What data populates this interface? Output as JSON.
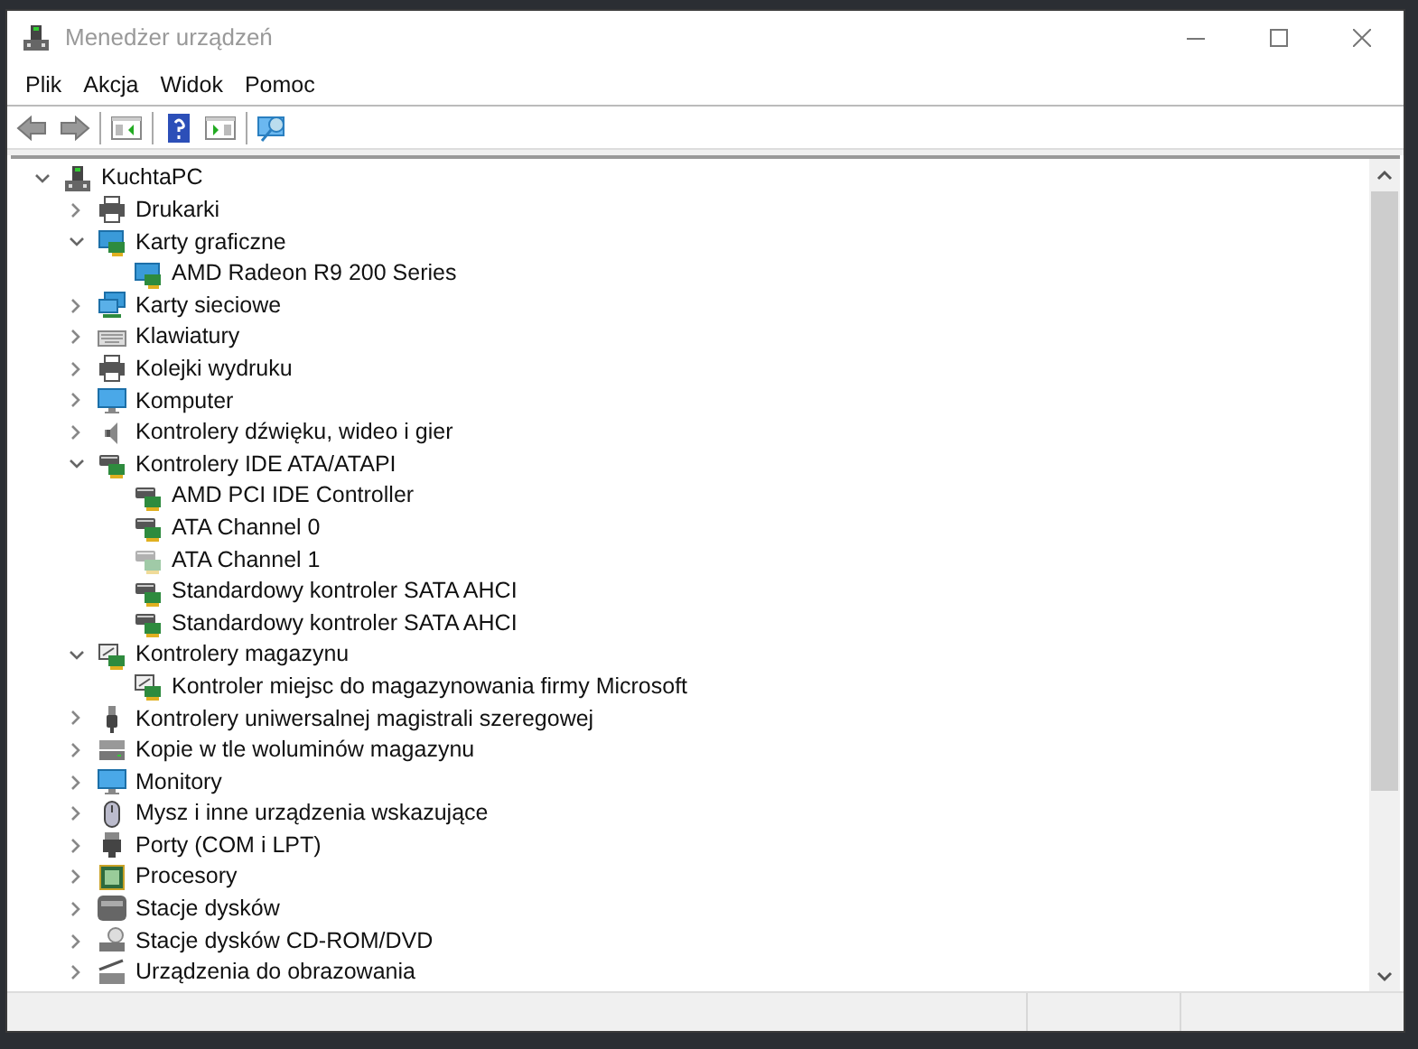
{
  "window": {
    "title": "Menedżer urządzeń"
  },
  "menu": [
    "Plik",
    "Akcja",
    "Widok",
    "Pomoc"
  ],
  "tree": {
    "label": "KuchtaPC",
    "kind": "computer",
    "expanded": true,
    "children": [
      {
        "label": "Drukarki",
        "kind": "printer",
        "expanded": false
      },
      {
        "label": "Karty graficzne",
        "kind": "display",
        "expanded": true,
        "children": [
          {
            "label": "AMD Radeon R9 200 Series",
            "kind": "display",
            "faded": false
          }
        ]
      },
      {
        "label": "Karty sieciowe",
        "kind": "network",
        "expanded": false
      },
      {
        "label": "Klawiatury",
        "kind": "keyboard",
        "expanded": false
      },
      {
        "label": "Kolejki wydruku",
        "kind": "printer",
        "expanded": false
      },
      {
        "label": "Komputer",
        "kind": "monitor",
        "expanded": false
      },
      {
        "label": "Kontrolery dźwięku, wideo i gier",
        "kind": "speaker",
        "expanded": false
      },
      {
        "label": "Kontrolery IDE ATA/ATAPI",
        "kind": "controller",
        "expanded": true,
        "children": [
          {
            "label": "AMD PCI IDE Controller",
            "kind": "controller",
            "faded": false
          },
          {
            "label": "ATA Channel 0",
            "kind": "controller",
            "faded": false
          },
          {
            "label": "ATA Channel 1",
            "kind": "controller",
            "faded": true
          },
          {
            "label": "Standardowy kontroler SATA AHCI",
            "kind": "controller",
            "faded": false
          },
          {
            "label": "Standardowy kontroler SATA AHCI",
            "kind": "controller",
            "faded": false
          }
        ]
      },
      {
        "label": "Kontrolery magazynu",
        "kind": "storage",
        "expanded": true,
        "children": [
          {
            "label": "Kontroler miejsc do magazynowania firmy Microsoft",
            "kind": "storage",
            "faded": false
          }
        ]
      },
      {
        "label": "Kontrolery uniwersalnej magistrali szeregowej",
        "kind": "usb",
        "expanded": false
      },
      {
        "label": "Kopie w tle woluminów magazynu",
        "kind": "volume",
        "expanded": false
      },
      {
        "label": "Monitory",
        "kind": "monitor",
        "expanded": false
      },
      {
        "label": "Mysz i inne urządzenia wskazujące",
        "kind": "mouse",
        "expanded": false
      },
      {
        "label": "Porty (COM i LPT)",
        "kind": "port",
        "expanded": false
      },
      {
        "label": "Procesory",
        "kind": "cpu",
        "expanded": false
      },
      {
        "label": "Stacje dysków",
        "kind": "disk",
        "expanded": false
      },
      {
        "label": "Stacje dysków CD-ROM/DVD",
        "kind": "cdrom",
        "expanded": false
      },
      {
        "label": "Urządzenia do obrazowania",
        "kind": "camera",
        "expanded": false
      }
    ]
  }
}
